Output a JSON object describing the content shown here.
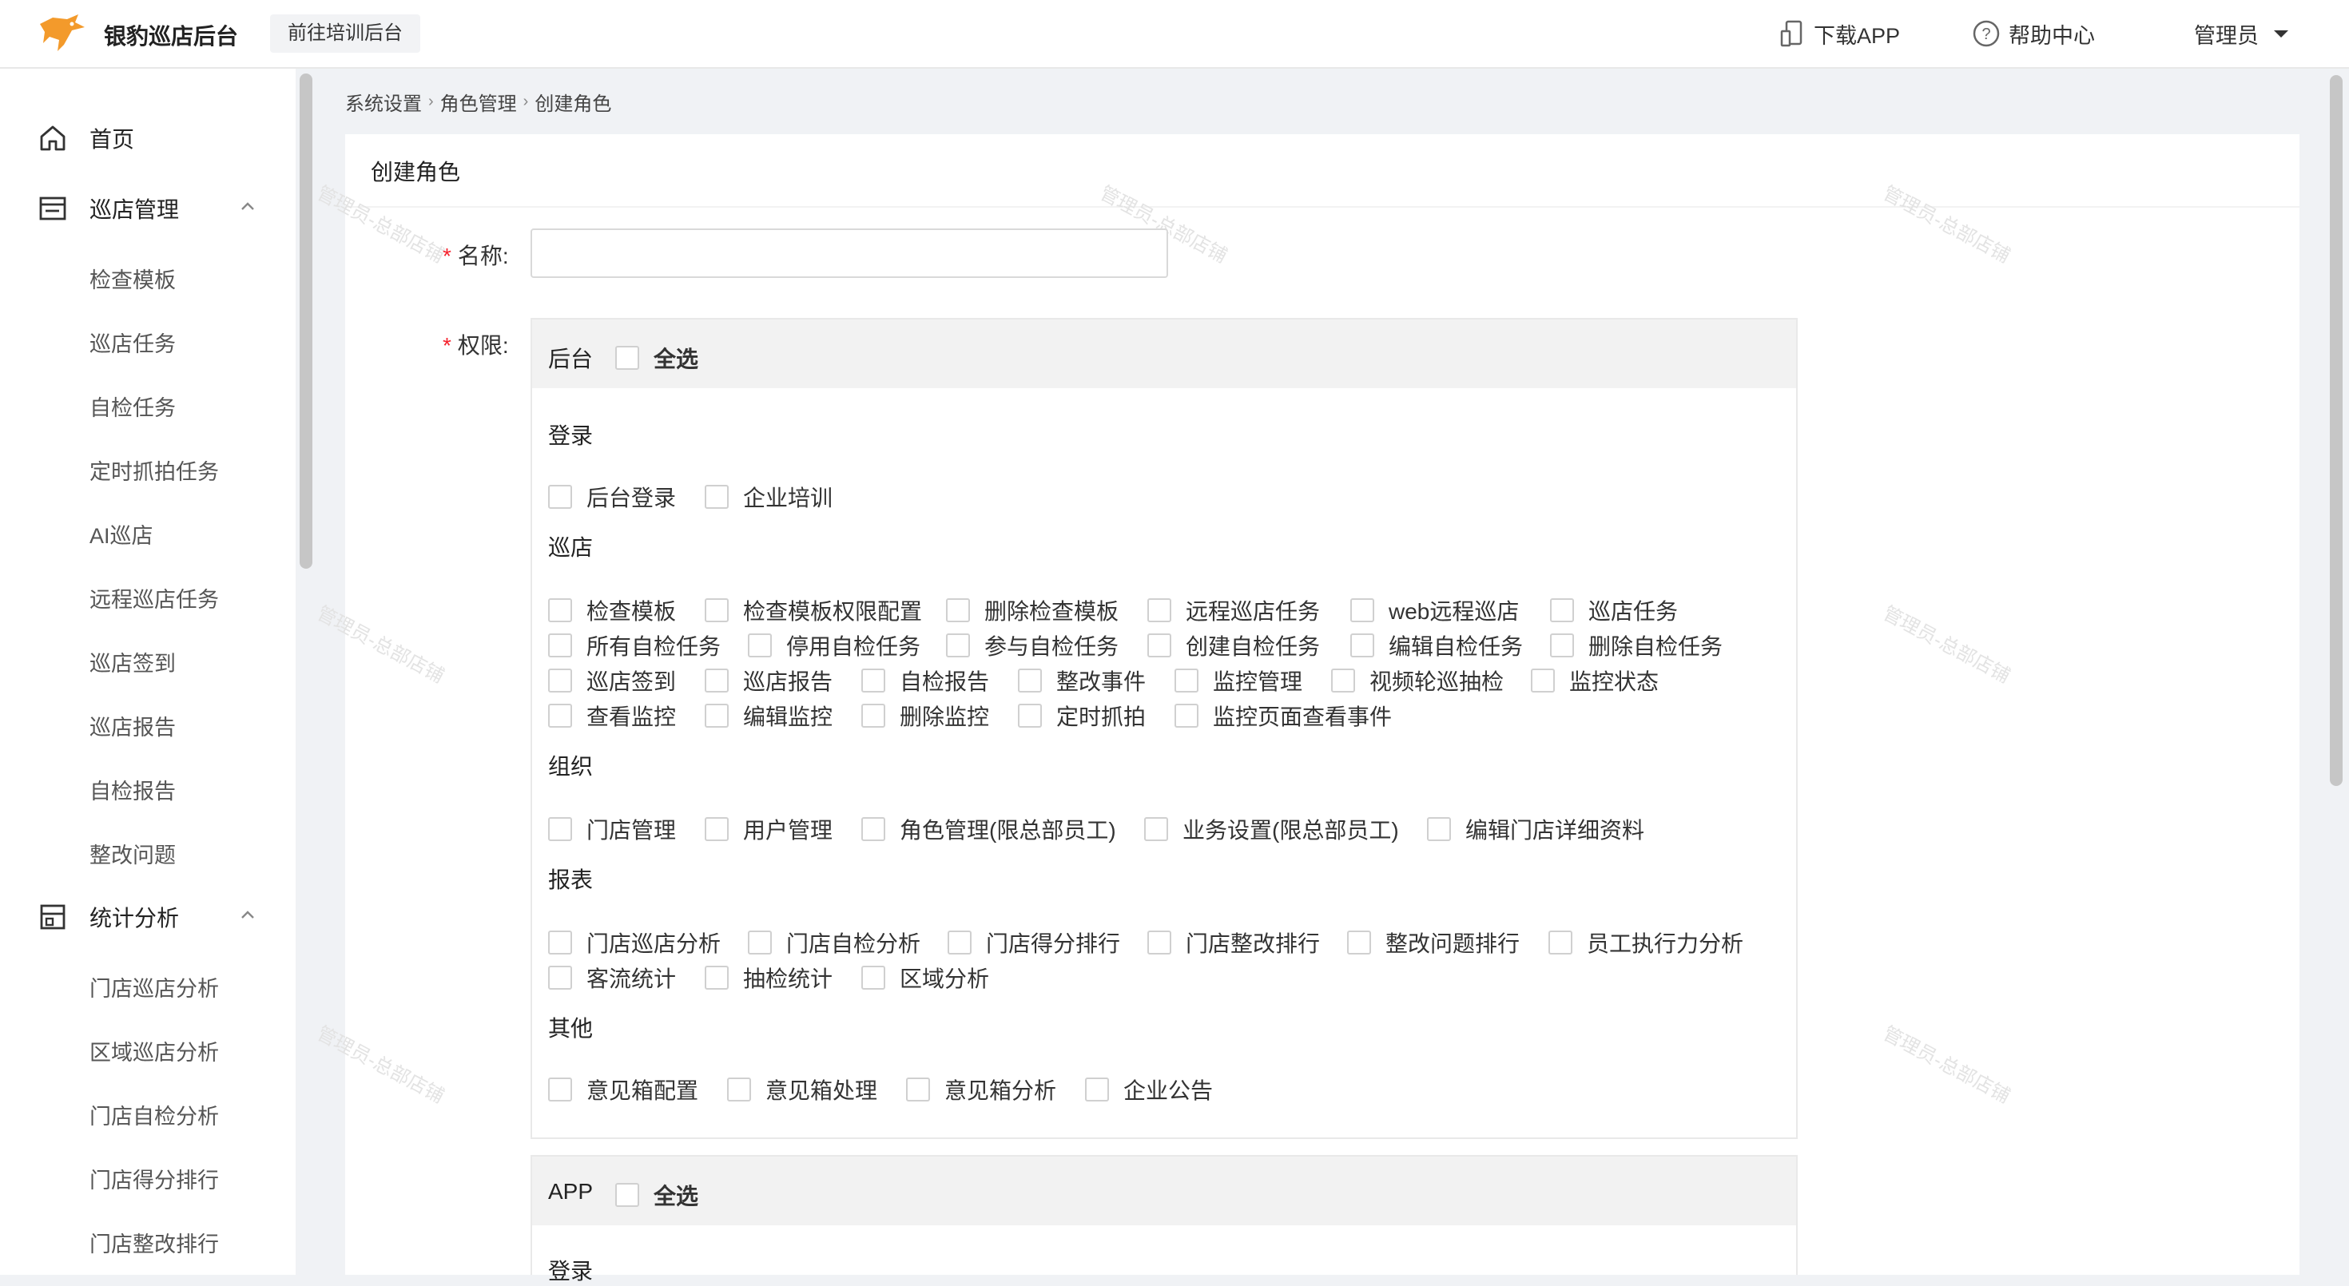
{
  "header": {
    "app_name": "银豹巡店后台",
    "training_button": "前往培训后台",
    "download_app": "下载APP",
    "help_center": "帮助中心",
    "user": "管理员"
  },
  "sidebar": {
    "home": "首页",
    "patrol_group": "巡店管理",
    "patrol_items": [
      "检查模板",
      "巡店任务",
      "自检任务",
      "定时抓拍任务",
      "AI巡店",
      "远程巡店任务",
      "巡店签到",
      "巡店报告",
      "自检报告",
      "整改问题"
    ],
    "stats_group": "统计分析",
    "stats_items": [
      "门店巡店分析",
      "区域巡店分析",
      "门店自检分析",
      "门店得分排行",
      "门店整改排行"
    ]
  },
  "breadcrumb": [
    "系统设置",
    "角色管理",
    "创建角色"
  ],
  "page_title": "创建角色",
  "form": {
    "name_label": "名称:",
    "name_value": "",
    "perm_label": "权限:",
    "backend": {
      "title": "后台",
      "select_all": "全选",
      "groups": {
        "login": {
          "title": "登录",
          "items": [
            "后台登录",
            "企业培训"
          ]
        },
        "patrol": {
          "title": "巡店",
          "rows": [
            [
              "检查模板",
              "检查模板权限配置",
              "删除检查模板",
              "远程巡店任务",
              "web远程巡店",
              "巡店任务"
            ],
            [
              "所有自检任务",
              "停用自检任务",
              "参与自检任务",
              "创建自检任务",
              "编辑自检任务",
              "删除自检任务"
            ],
            [
              "巡店签到",
              "巡店报告",
              "自检报告",
              "整改事件",
              "监控管理",
              "视频轮巡抽检",
              "监控状态"
            ],
            [
              "查看监控",
              "编辑监控",
              "删除监控",
              "定时抓拍",
              "监控页面查看事件"
            ]
          ]
        },
        "org": {
          "title": "组织",
          "items": [
            "门店管理",
            "用户管理",
            "角色管理(限总部员工)",
            "业务设置(限总部员工)",
            "编辑门店详细资料"
          ]
        },
        "report": {
          "title": "报表",
          "rows": [
            [
              "门店巡店分析",
              "门店自检分析",
              "门店得分排行",
              "门店整改排行",
              "整改问题排行",
              "员工执行力分析"
            ],
            [
              "客流统计",
              "抽检统计",
              "区域分析"
            ]
          ]
        },
        "other": {
          "title": "其他",
          "items": [
            "意见箱配置",
            "意见箱处理",
            "意见箱分析",
            "企业公告"
          ]
        }
      }
    },
    "app": {
      "title": "APP",
      "select_all": "全选",
      "login_title": "登录"
    }
  },
  "watermark": "管理员-总部店铺",
  "colors": {
    "required": "#f5222d",
    "logo": "#f39a2b"
  }
}
